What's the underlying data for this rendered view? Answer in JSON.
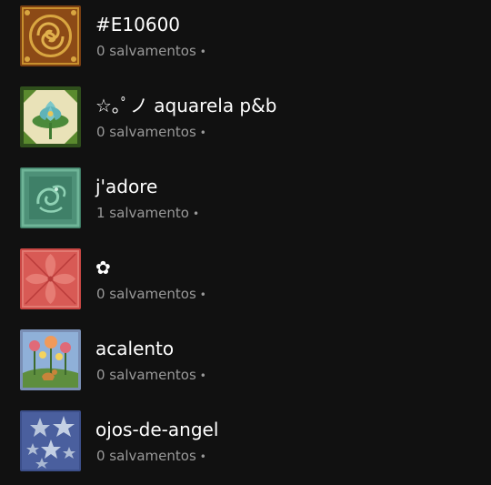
{
  "boards": [
    {
      "title": "#E10600",
      "saves": "0 salvamentos",
      "separator": "•",
      "thumbnail": "brown-gold-swirl-tile"
    },
    {
      "title": "☆｡ﾟノ aquarela p&b",
      "saves": "0 salvamentos",
      "separator": "•",
      "thumbnail": "green-lotus-tile"
    },
    {
      "title": "j'adore",
      "saves": "1 salvamento",
      "separator": "•",
      "thumbnail": "jade-bird-tile"
    },
    {
      "title": "✿",
      "saves": "0 salvamentos",
      "separator": "•",
      "thumbnail": "coral-leaf-tile"
    },
    {
      "title": "acalento",
      "saves": "0 salvamentos",
      "separator": "•",
      "thumbnail": "flower-garden-tile"
    },
    {
      "title": "ojos-de-angel",
      "saves": "0 salvamentos",
      "separator": "•",
      "thumbnail": "blue-star-tile"
    }
  ],
  "colors": {
    "background": "#111111",
    "title_text": "#ffffff",
    "meta_text": "#9a9a9a"
  }
}
